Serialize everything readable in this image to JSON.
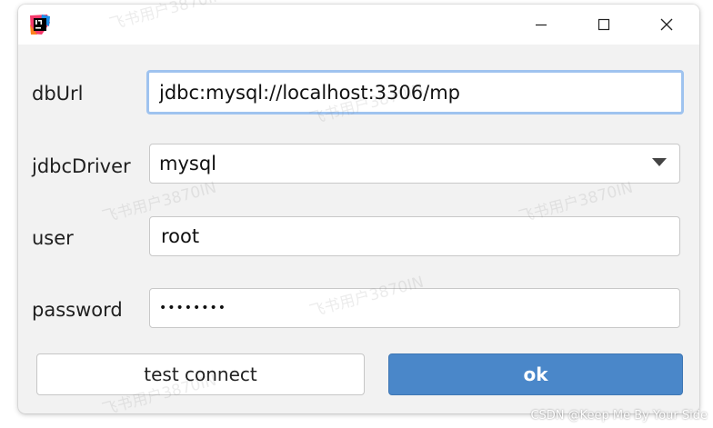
{
  "window": {
    "app_icon": "intellij-idea-icon",
    "controls": {
      "minimize_icon": "minimize-icon",
      "maximize_icon": "maximize-icon",
      "close_icon": "close-icon"
    }
  },
  "form": {
    "db_url": {
      "label": "dbUrl",
      "value": "jdbc:mysql://localhost:3306/mp"
    },
    "jdbc_driver": {
      "label": "jdbcDriver",
      "selected": "mysql",
      "arrow_icon": "chevron-down-icon"
    },
    "user": {
      "label": "user",
      "value": "root"
    },
    "password": {
      "label": "password",
      "value": "••••••••"
    }
  },
  "actions": {
    "test_connect_label": "test connect",
    "ok_label": "ok"
  },
  "overlay": {
    "watermark_text": "飞书用户3870IN",
    "source_credit": "CSDN @Keep Me By Your Side"
  },
  "colors": {
    "primary_button": "#4a87c9",
    "focus_ring": "#9fc3ef",
    "dialog_background": "#f2f2f2"
  }
}
